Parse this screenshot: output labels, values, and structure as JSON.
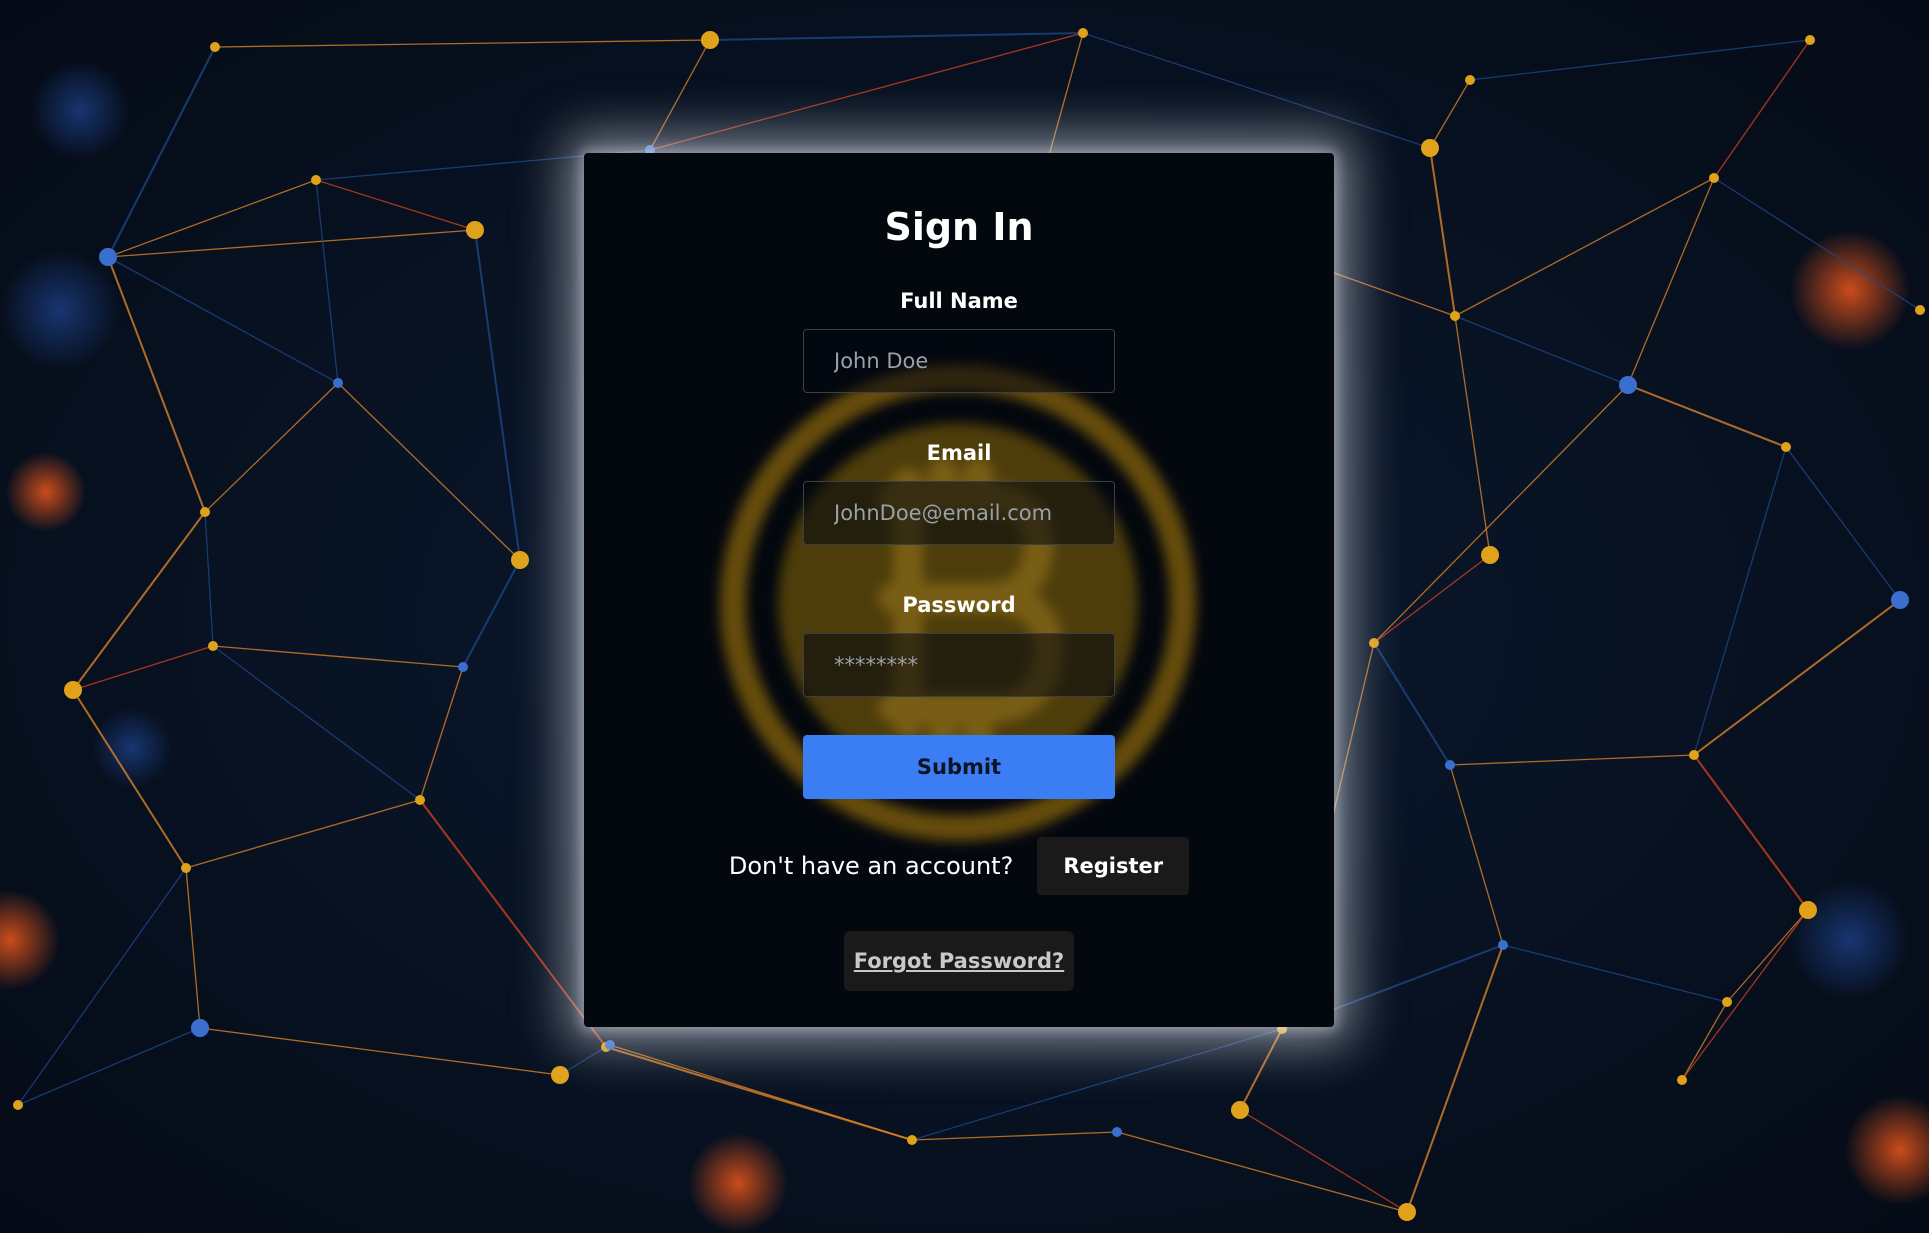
{
  "form": {
    "title": "Sign In",
    "full_name_label": "Full Name",
    "full_name_placeholder": "John Doe",
    "email_label": "Email",
    "email_placeholder": "JohnDoe@email.com",
    "password_label": "Password",
    "password_placeholder": "********",
    "submit_label": "Submit",
    "no_account_text": "Don't have an account?",
    "register_label": "Register",
    "forgot_label": "Forgot Password?"
  },
  "colors": {
    "background": "#07101f",
    "card": "#03070e",
    "primary_button": "#3b7df2",
    "secondary_button": "#1a1a1a",
    "network_orange": "#e8892a",
    "network_blue": "#1e4a8c",
    "coin": "#c99a0e"
  },
  "background_image": {
    "description_icon": "network-graph-background",
    "center_icon": "bitcoin-icon"
  }
}
